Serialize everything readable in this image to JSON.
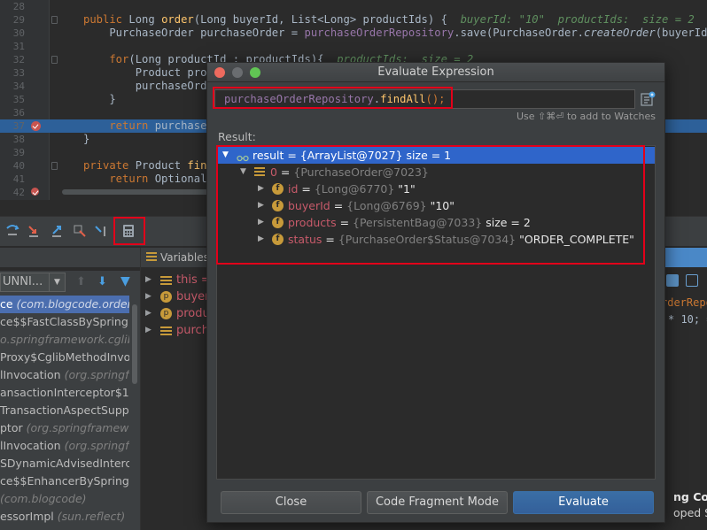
{
  "editor": {
    "lines": [
      {
        "num": "28",
        "top": 0
      },
      {
        "num": "29",
        "parts": [
          [
            "kw",
            "public "
          ],
          [
            "",
            "Long "
          ],
          [
            "fn",
            "order"
          ],
          [
            "",
            "(Long buyerId, List<Long> productIds) {  "
          ],
          [
            "hint",
            "buyerId: \"10\"  productIds:  size = 2"
          ]
        ]
      },
      {
        "num": "30",
        "parts": [
          [
            "",
            "    PurchaseOrder purchaseOrder = "
          ],
          [
            "pur",
            "purchaseOrderRepository"
          ],
          [
            "",
            ".save(PurchaseOrder."
          ],
          [
            "it",
            "createOrder"
          ],
          [
            "",
            "(buyerId));"
          ]
        ]
      },
      {
        "num": "31",
        "parts": []
      },
      {
        "num": "32",
        "parts": [
          [
            "kw",
            "    for"
          ],
          [
            "",
            "(Long productId : productIds){  "
          ],
          [
            "hint",
            "productIds:  size = 2"
          ]
        ]
      },
      {
        "num": "33",
        "parts": [
          [
            "",
            "        Product prod"
          ]
        ]
      },
      {
        "num": "34",
        "parts": [
          [
            "",
            "        purchaseOrde"
          ]
        ]
      },
      {
        "num": "35",
        "parts": [
          [
            "",
            "    }"
          ]
        ]
      },
      {
        "num": "36",
        "parts": []
      },
      {
        "num": "37",
        "parts": [
          [
            "kw",
            "    return "
          ],
          [
            "",
            "purchaseO"
          ]
        ]
      },
      {
        "num": "38",
        "parts": [
          [
            "",
            "}"
          ]
        ]
      },
      {
        "num": "39",
        "parts": []
      },
      {
        "num": "40",
        "parts": [
          [
            "kw",
            "private "
          ],
          [
            "",
            "Product "
          ],
          [
            "fn",
            "find"
          ]
        ]
      },
      {
        "num": "41",
        "parts": [
          [
            "kw",
            "    return "
          ],
          [
            "",
            "Optional."
          ]
        ]
      },
      {
        "num": "42",
        "parts": []
      }
    ]
  },
  "frames": {
    "thread_label": "UNNI...",
    "items": [
      {
        "name": "ce ",
        "pkg": "(com.blogcode.order",
        "selected": true
      },
      {
        "name": "ce$$FastClassBySpring",
        "pkg": "",
        "selected": false
      },
      {
        "name": "",
        "pkg": "o.springframework.cglib",
        "selected": false
      },
      {
        "name": "Proxy$CglibMethodInvo",
        "pkg": "",
        "selected": false
      },
      {
        "name": "lInvocation ",
        "pkg": "(org.springf",
        "selected": false
      },
      {
        "name": "ansactionInterceptor$1",
        "pkg": "",
        "selected": false
      },
      {
        "name": " TransactionAspectSupp",
        "pkg": "",
        "selected": false
      },
      {
        "name": "ptor ",
        "pkg": "(org.springframew",
        "selected": false
      },
      {
        "name": "lInvocation ",
        "pkg": "(org.springf",
        "selected": false
      },
      {
        "name": "SDynamicAdvisedIntercep",
        "pkg": "",
        "selected": false
      },
      {
        "name": "ce$$EnhancerBySpringC",
        "pkg": "",
        "selected": false
      },
      {
        "name": "",
        "pkg": "(com.blogcode)",
        "selected": false
      },
      {
        "name": "essorImpl ",
        "pkg": "(sun.reflect)",
        "selected": false
      }
    ]
  },
  "variables": {
    "header": "Variables",
    "items": [
      {
        "name": "this",
        "suffix": " =",
        "icon": "list"
      },
      {
        "name": "buyer",
        "suffix": "",
        "icon": "p"
      },
      {
        "name": "produ",
        "suffix": "",
        "icon": "p"
      },
      {
        "name": "purch",
        "suffix": "",
        "icon": "list"
      }
    ]
  },
  "right_strip": {
    "line1": "rderRepos",
    "line2": "* 10; =",
    "notif1": "ng Confic",
    "notif2": "oped Spr"
  },
  "dialog": {
    "title": "Evaluate Expression",
    "expression": {
      "part1": "purchaseOrderRepository",
      "part2": ".",
      "part3": "findAll",
      "part4": "();"
    },
    "watch_hint": "Use ⇧⌘⏎ to add to Watches",
    "result_label": "Result:",
    "tree": [
      {
        "name": "result",
        "eq": " = ",
        "type": "{ArrayList@7027}",
        "value": "  size = 1",
        "level": 0,
        "expanded": true,
        "selected": true,
        "icon": "watch"
      },
      {
        "name": "0",
        "eq": " = ",
        "type": "{PurchaseOrder@7023}",
        "value": "",
        "level": 1,
        "expanded": true,
        "selected": false,
        "icon": "list"
      },
      {
        "name": "id",
        "eq": " = ",
        "type": "{Long@6770}",
        "value": " \"1\"",
        "level": 2,
        "expanded": false,
        "selected": false,
        "icon": "f"
      },
      {
        "name": "buyerId",
        "eq": " = ",
        "type": "{Long@6769}",
        "value": " \"10\"",
        "level": 2,
        "expanded": false,
        "selected": false,
        "icon": "f"
      },
      {
        "name": "products",
        "eq": " = ",
        "type": "{PersistentBag@7033}",
        "value": "  size = 2",
        "level": 2,
        "expanded": false,
        "selected": false,
        "icon": "f"
      },
      {
        "name": "status",
        "eq": " = ",
        "type": "{PurchaseOrder$Status@7034}",
        "value": " \"ORDER_COMPLETE\"",
        "level": 2,
        "expanded": false,
        "selected": false,
        "icon": "f"
      }
    ],
    "buttons": {
      "close": "Close",
      "fragment": "Code Fragment Mode",
      "evaluate": "Evaluate"
    }
  },
  "colors": {
    "highlight_box": "#e2001a",
    "selection": "#2f65ca",
    "field_icon": "#c79a3a"
  }
}
